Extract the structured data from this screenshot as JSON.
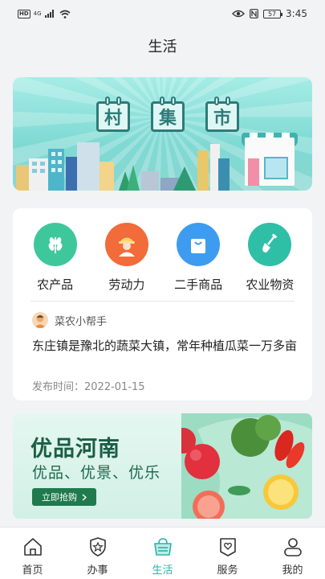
{
  "status_bar": {
    "hd": "HD",
    "network": "4G",
    "battery": "57",
    "time": "3:45"
  },
  "header": {
    "title": "生活"
  },
  "banner": {
    "signs": [
      "村",
      "集",
      "市"
    ]
  },
  "categories": [
    {
      "label": "农产品",
      "icon": "wheat-icon",
      "color": "#3fc79c"
    },
    {
      "label": "劳动力",
      "icon": "worker-icon",
      "color": "#f26b3a"
    },
    {
      "label": "二手商品",
      "icon": "shopping-bag-icon",
      "color": "#3d9cf0"
    },
    {
      "label": "农业物资",
      "icon": "shovel-icon",
      "color": "#2fbfa6"
    }
  ],
  "news": {
    "author": "菜农小帮手",
    "title": "东庄镇是豫北的蔬菜大镇，常年种植瓜菜一万多亩",
    "time_label": "发布时间：",
    "time_value": "2022-01-15"
  },
  "promo": {
    "title": "优品河南",
    "subtitle": "优品、优景、优乐",
    "button_label": "立即抢购",
    "accent": "#207a4e"
  },
  "tabbar": {
    "items": [
      {
        "label": "首页",
        "icon": "home-icon",
        "active": false
      },
      {
        "label": "办事",
        "icon": "shield-star-icon",
        "active": false
      },
      {
        "label": "生活",
        "icon": "basket-icon",
        "active": true
      },
      {
        "label": "服务",
        "icon": "heart-tag-icon",
        "active": false
      },
      {
        "label": "我的",
        "icon": "person-icon",
        "active": false
      }
    ],
    "active_color": "#2bb3a8"
  }
}
